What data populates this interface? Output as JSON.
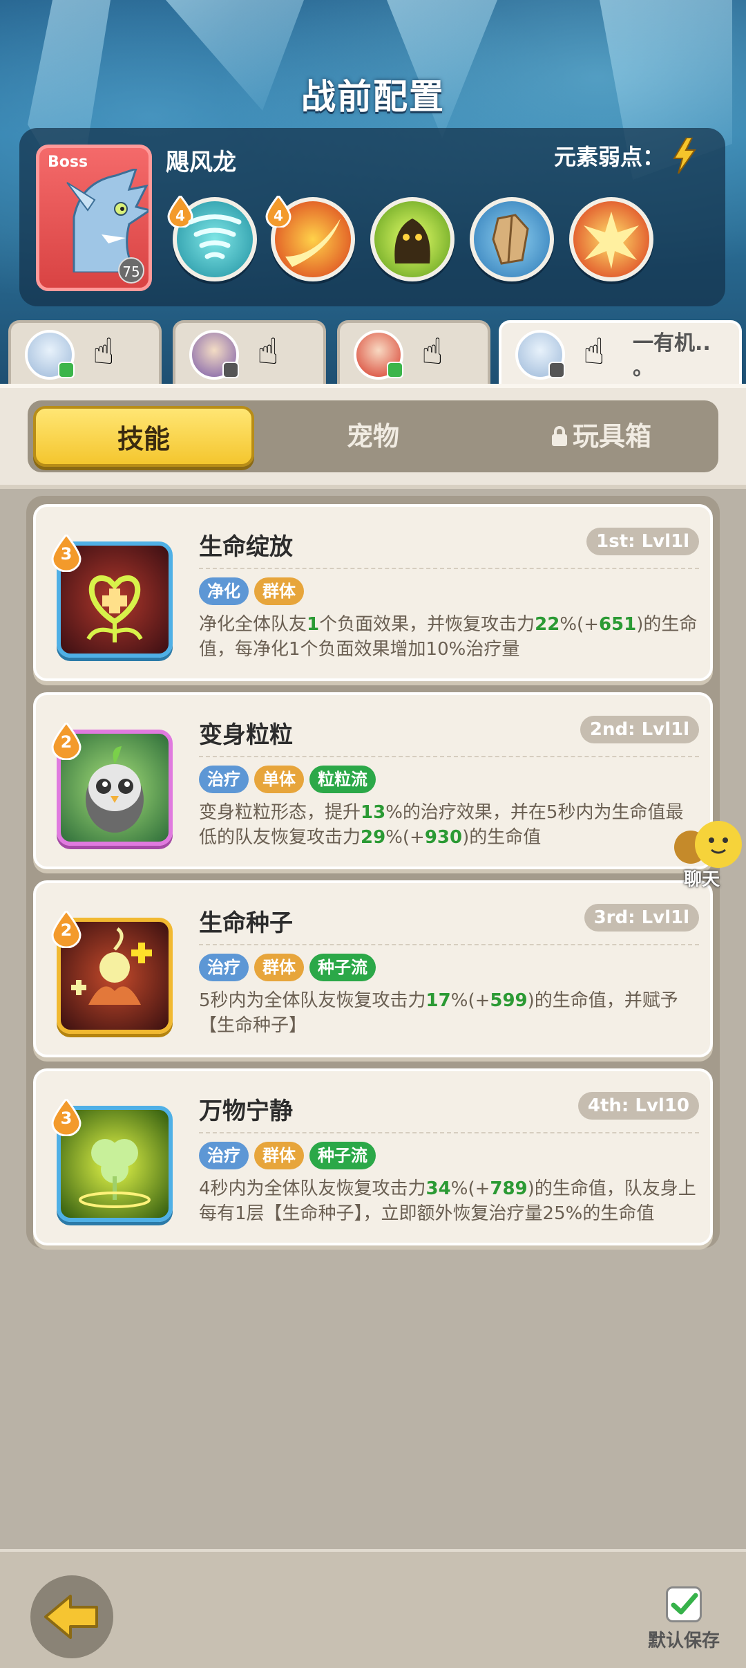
{
  "header": {
    "title": "战前配置"
  },
  "boss": {
    "tag": "Boss",
    "level": "75",
    "name": "飓风龙",
    "weakness_label": "元素弱点：",
    "skill_costs": [
      "4",
      "4"
    ]
  },
  "team": {
    "extra_text": "一有机..",
    "extra_dot": "。"
  },
  "tabs": [
    "技能",
    "宠物",
    "玩具箱"
  ],
  "skills": [
    {
      "name": "生命绽放",
      "rank": "1st: Lvl1l",
      "cost": "3",
      "tags": [
        "净化",
        "群体"
      ],
      "desc_parts": [
        "净化全体队友",
        "1",
        "个负面效果，并恢复攻击力",
        "22",
        "%(+",
        "651",
        ")的生命值，每净化1个负面效果增加10%治疗量"
      ]
    },
    {
      "name": "变身粒粒",
      "rank": "2nd: Lvl1l",
      "cost": "2",
      "tags": [
        "治疗",
        "单体",
        "粒粒流"
      ],
      "desc_parts": [
        "变身粒粒形态，提升",
        "13",
        "%的治疗效果，并在5秒内为生命值最低的队友恢复攻击力",
        "29",
        "%(+",
        "930",
        ")的生命值"
      ]
    },
    {
      "name": "生命种子",
      "rank": "3rd: Lvl1l",
      "cost": "2",
      "tags": [
        "治疗",
        "群体",
        "种子流"
      ],
      "desc_parts": [
        "5秒内为全体队友恢复攻击力",
        "17",
        "%(+",
        "599",
        ")的生命值，并赋予【生命种子】"
      ]
    },
    {
      "name": "万物宁静",
      "rank": "4th: Lvl10",
      "cost": "3",
      "tags": [
        "治疗",
        "群体",
        "种子流"
      ],
      "desc_parts": [
        "4秒内为全体队友恢复攻击力",
        "34",
        "%(+",
        "789",
        ")的生命值，队友身上每有1层【生命种子】，立即额外恢复治疗量25%的生命值"
      ]
    }
  ],
  "chat": {
    "label": "聊天"
  },
  "footer": {
    "save_label": "默认保存"
  },
  "colors": {
    "accent": "#f4c62e",
    "highlight": "#2b9a34",
    "tag_blue": "#5d97d5",
    "tag_orange": "#e7a53b",
    "tag_green": "#2ba848"
  },
  "icons": [
    "lightning-icon",
    "tornado-icon",
    "fire-slash-icon",
    "shadow-beast-icon",
    "rock-shield-icon",
    "explosion-icon",
    "hand-pointer-icon",
    "lock-icon",
    "back-arrow-icon",
    "checkbox-icon",
    "chat-bubble-icon"
  ]
}
